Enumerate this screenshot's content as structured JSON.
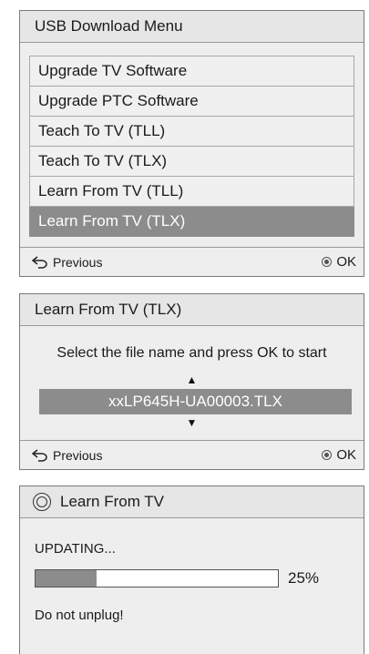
{
  "menu_panel": {
    "title": "USB Download Menu",
    "items": [
      {
        "label": "Upgrade TV Software",
        "selected": false
      },
      {
        "label": "Upgrade PTC Software",
        "selected": false
      },
      {
        "label": "Teach To TV (TLL)",
        "selected": false
      },
      {
        "label": "Teach To TV (TLX)",
        "selected": false
      },
      {
        "label": "Learn From TV (TLL)",
        "selected": false
      },
      {
        "label": "Learn From TV (TLX)",
        "selected": true
      }
    ],
    "footer": {
      "previous_label": "Previous",
      "ok_label": "OK",
      "previous_icon": "back-arrow-icon",
      "ok_icon": "ok-circle-icon"
    }
  },
  "learn_panel": {
    "title": "Learn From TV (TLX)",
    "instruction": "Select the file name and press OK to start",
    "filename": "xxLP645H-UA00003.TLX",
    "up_arrow": "▲",
    "down_arrow": "▼",
    "footer": {
      "previous_label": "Previous",
      "ok_label": "OK",
      "previous_icon": "back-arrow-icon",
      "ok_icon": "ok-circle-icon"
    }
  },
  "update_panel": {
    "title": "Learn From TV",
    "title_icon": "info-icon",
    "status": "UPDATING...",
    "progress_fraction": 0.25,
    "progress_text": "25%",
    "warning": "Do not unplug!"
  },
  "colors": {
    "selected_bg": "#8c8c8c",
    "panel_bg": "#eeeeee",
    "progress_fill": "#8c8c8c"
  }
}
